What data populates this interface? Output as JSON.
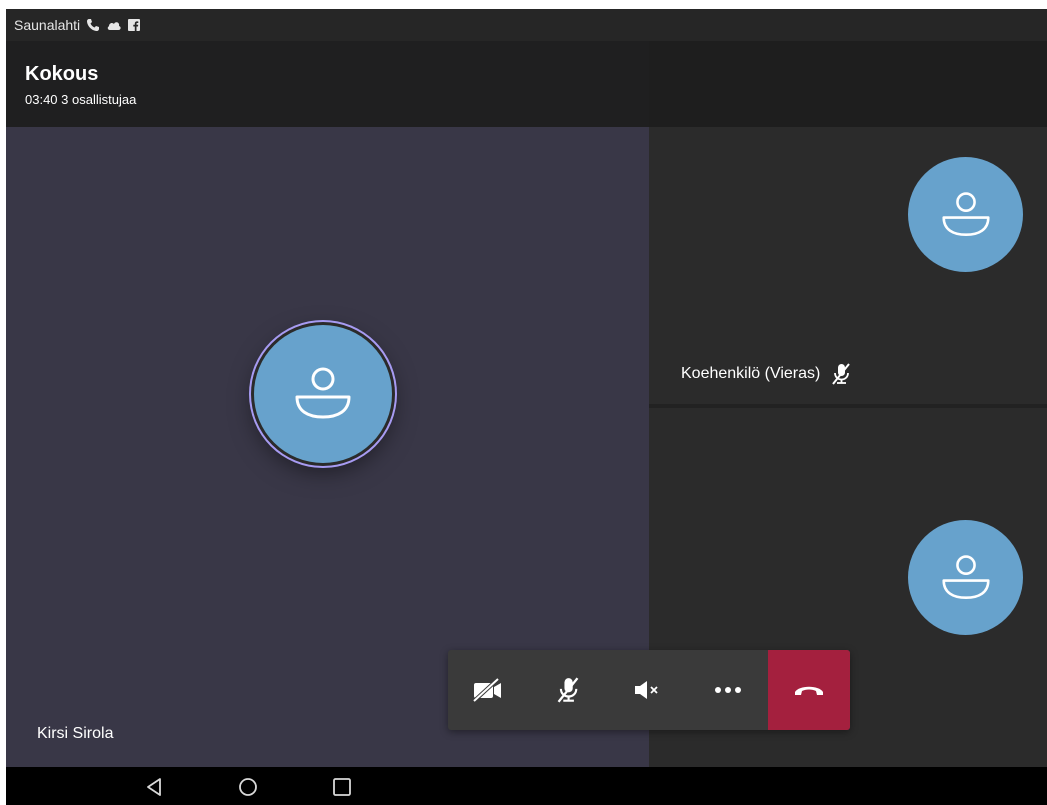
{
  "status_bar": {
    "carrier": "Saunalahti",
    "icons": [
      "phone-icon",
      "cloud-icon",
      "facebook-icon"
    ]
  },
  "meeting": {
    "title": "Kokous",
    "subtitle": "03:40 3 osallistujaa"
  },
  "participants": {
    "main": {
      "name": "Kirsi Sirola",
      "avatar_color": "#67a2cc",
      "speaking_ring": "#a79bf2"
    },
    "side": [
      {
        "name": "Koehenkilö (Vieras)",
        "muted": true
      },
      {
        "name": ""
      }
    ]
  },
  "controls": {
    "items": [
      "video-off-icon",
      "mic-off-icon",
      "speaker-off-icon",
      "more-icon",
      "hangup-icon"
    ],
    "hangup_color": "#a4203e"
  },
  "nav": {
    "items": [
      "back-icon",
      "home-icon",
      "recents-icon"
    ]
  }
}
